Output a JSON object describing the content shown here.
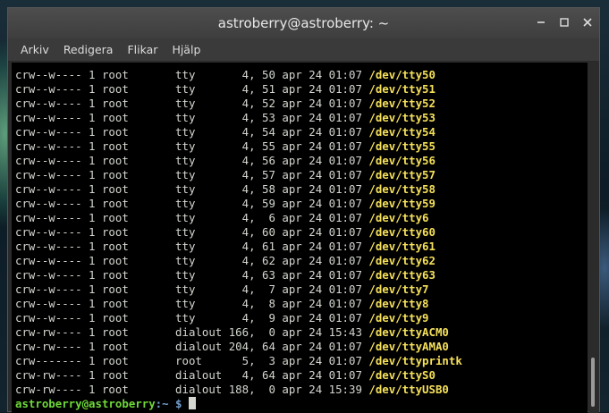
{
  "window": {
    "title": "astroberry@astroberry: ~"
  },
  "menu": {
    "items": [
      "Arkiv",
      "Redigera",
      "Flikar",
      "Hjälp"
    ]
  },
  "terminal": {
    "lines": [
      {
        "prefix": "crw--w---- 1 root       tty       4, 50 apr 24 01:07 ",
        "name": "/dev/tty50"
      },
      {
        "prefix": "crw--w---- 1 root       tty       4, 51 apr 24 01:07 ",
        "name": "/dev/tty51"
      },
      {
        "prefix": "crw--w---- 1 root       tty       4, 52 apr 24 01:07 ",
        "name": "/dev/tty52"
      },
      {
        "prefix": "crw--w---- 1 root       tty       4, 53 apr 24 01:07 ",
        "name": "/dev/tty53"
      },
      {
        "prefix": "crw--w---- 1 root       tty       4, 54 apr 24 01:07 ",
        "name": "/dev/tty54"
      },
      {
        "prefix": "crw--w---- 1 root       tty       4, 55 apr 24 01:07 ",
        "name": "/dev/tty55"
      },
      {
        "prefix": "crw--w---- 1 root       tty       4, 56 apr 24 01:07 ",
        "name": "/dev/tty56"
      },
      {
        "prefix": "crw--w---- 1 root       tty       4, 57 apr 24 01:07 ",
        "name": "/dev/tty57"
      },
      {
        "prefix": "crw--w---- 1 root       tty       4, 58 apr 24 01:07 ",
        "name": "/dev/tty58"
      },
      {
        "prefix": "crw--w---- 1 root       tty       4, 59 apr 24 01:07 ",
        "name": "/dev/tty59"
      },
      {
        "prefix": "crw--w---- 1 root       tty       4,  6 apr 24 01:07 ",
        "name": "/dev/tty6"
      },
      {
        "prefix": "crw--w---- 1 root       tty       4, 60 apr 24 01:07 ",
        "name": "/dev/tty60"
      },
      {
        "prefix": "crw--w---- 1 root       tty       4, 61 apr 24 01:07 ",
        "name": "/dev/tty61"
      },
      {
        "prefix": "crw--w---- 1 root       tty       4, 62 apr 24 01:07 ",
        "name": "/dev/tty62"
      },
      {
        "prefix": "crw--w---- 1 root       tty       4, 63 apr 24 01:07 ",
        "name": "/dev/tty63"
      },
      {
        "prefix": "crw--w---- 1 root       tty       4,  7 apr 24 01:07 ",
        "name": "/dev/tty7"
      },
      {
        "prefix": "crw--w---- 1 root       tty       4,  8 apr 24 01:07 ",
        "name": "/dev/tty8"
      },
      {
        "prefix": "crw--w---- 1 root       tty       4,  9 apr 24 01:07 ",
        "name": "/dev/tty9"
      },
      {
        "prefix": "crw-rw---- 1 root       dialout 166,  0 apr 24 15:43 ",
        "name": "/dev/ttyACM0"
      },
      {
        "prefix": "crw-rw---- 1 root       dialout 204, 64 apr 24 01:07 ",
        "name": "/dev/ttyAMA0"
      },
      {
        "prefix": "crw------- 1 root       root      5,  3 apr 24 01:07 ",
        "name": "/dev/ttyprintk"
      },
      {
        "prefix": "crw-rw---- 1 root       dialout   4, 64 apr 24 01:07 ",
        "name": "/dev/ttyS0"
      },
      {
        "prefix": "crw-rw---- 1 root       dialout 188,  0 apr 24 15:39 ",
        "name": "/dev/ttyUSB0"
      }
    ],
    "prompt": {
      "user": "astroberry@astroberry",
      "sep": ":",
      "path": "~",
      "symbol": " $ "
    }
  },
  "colors": {
    "filename": "#f5e05a",
    "prompt_user": "#6ed838",
    "prompt_path": "#729fcf"
  }
}
